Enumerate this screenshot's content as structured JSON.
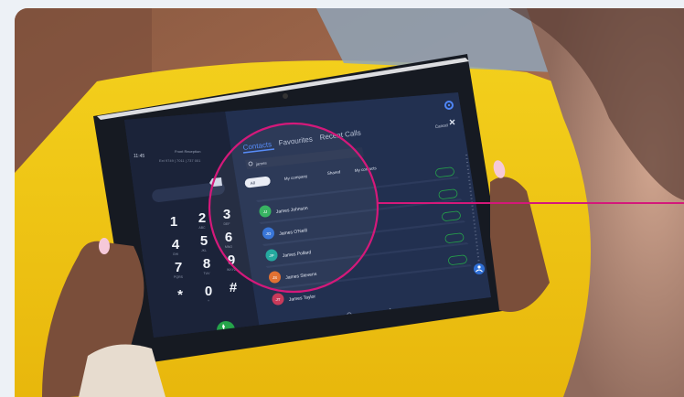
{
  "colors": {
    "page_bg": "#edf1f6",
    "yellow": "#f6d21a",
    "screen_bg": "#1f2a44",
    "dialer_bg": "#1b2339",
    "accent_blue": "#4f86f7",
    "callout": "#d4197a",
    "call_green": "#25a44a"
  },
  "dialer": {
    "clock": "11:45",
    "caller_name": "Front Reception",
    "caller_sub": "Ext 9749 | 7011 | 737 001",
    "keys": [
      {
        "digit": "1",
        "letters": ""
      },
      {
        "digit": "2",
        "letters": "ABC"
      },
      {
        "digit": "3",
        "letters": "DEF"
      },
      {
        "digit": "4",
        "letters": "GHI"
      },
      {
        "digit": "5",
        "letters": "JKL"
      },
      {
        "digit": "6",
        "letters": "MNO"
      },
      {
        "digit": "7",
        "letters": "PQRS"
      },
      {
        "digit": "8",
        "letters": "TUV"
      },
      {
        "digit": "9",
        "letters": "WXYZ"
      },
      {
        "digit": "*",
        "letters": ""
      },
      {
        "digit": "0",
        "letters": "+"
      },
      {
        "digit": "#",
        "letters": ""
      }
    ]
  },
  "tabs": [
    {
      "label": "Contacts",
      "active": true
    },
    {
      "label": "Favourites",
      "active": false
    },
    {
      "label": "Recent Calls",
      "active": false
    }
  ],
  "cancel_label": "Cancel",
  "search_value": "james",
  "filters": [
    {
      "label": "All",
      "active": true
    },
    {
      "label": "My company",
      "active": false
    },
    {
      "label": "Shared",
      "active": false
    },
    {
      "label": "My contacts",
      "active": false
    }
  ],
  "contacts": [
    {
      "initials": "JJ",
      "name": "James Johnson",
      "color": "#2eaf5a"
    },
    {
      "initials": "JO",
      "name": "James O'Neill",
      "color": "#2f6fd6"
    },
    {
      "initials": "JP",
      "name": "James Pollard",
      "color": "#1aa59a"
    },
    {
      "initials": "JS",
      "name": "James Stevens",
      "color": "#e06a28"
    },
    {
      "initials": "JT",
      "name": "James Taylor",
      "color": "#c93a5a"
    }
  ],
  "icons": [
    "settings-gear-icon",
    "close-icon",
    "search-icon",
    "backspace-icon",
    "phone-icon",
    "add-contact-icon"
  ]
}
